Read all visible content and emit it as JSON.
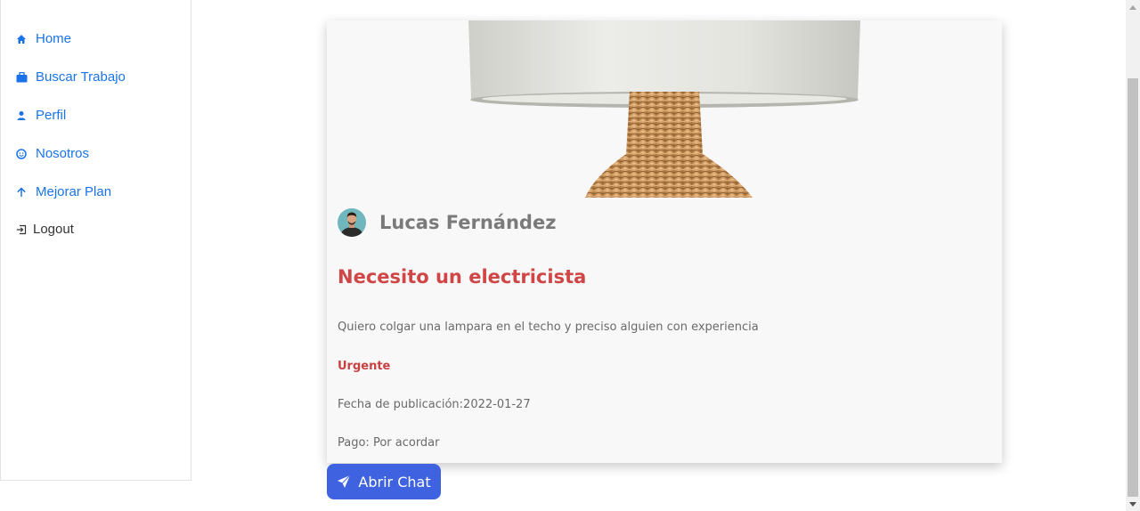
{
  "sidebar": {
    "items": [
      {
        "label": "Home",
        "icon": "home-icon"
      },
      {
        "label": "Buscar Trabajo",
        "icon": "briefcase-icon"
      },
      {
        "label": "Perfil",
        "icon": "person-icon"
      },
      {
        "label": "Nosotros",
        "icon": "smiley-icon"
      },
      {
        "label": "Mejorar Plan",
        "icon": "arrow-up-icon"
      },
      {
        "label": "Logout",
        "icon": "logout-icon"
      }
    ]
  },
  "post": {
    "image": "lamp-photo",
    "author": "Lucas Fernández",
    "title": "Necesito un electricista",
    "description": "Quiero colgar una lampara en el techo y preciso alguien con experiencia",
    "urgency": "Urgente",
    "date_text": "Fecha de publicación:2022-01-27",
    "payment_text": "Pago: Por acordar"
  },
  "chat_button": {
    "label": "Abrir Chat",
    "icon": "send-icon"
  },
  "colors": {
    "nav_link": "#1a73e8",
    "title_red": "#d04545",
    "button_blue": "#3f63e0",
    "card_bg": "#f8f8f8"
  }
}
